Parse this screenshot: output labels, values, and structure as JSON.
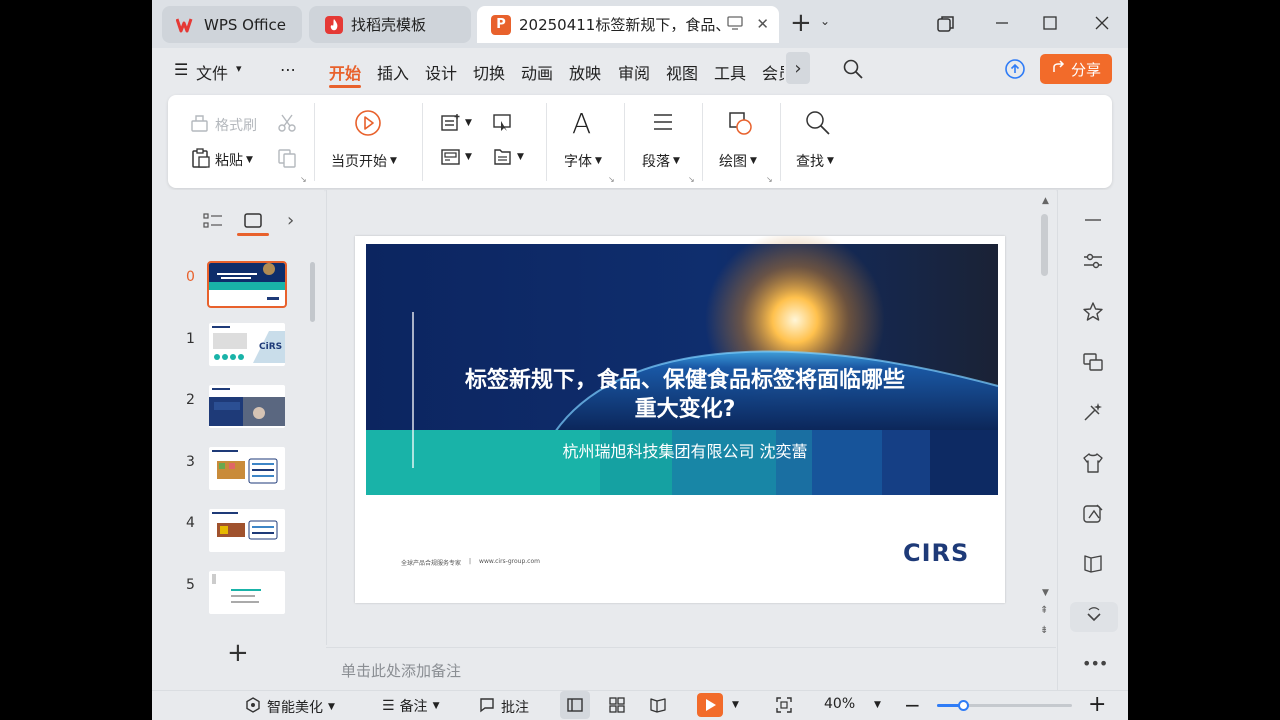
{
  "tabs": [
    {
      "label": "WPS Office",
      "icon": "wps-logo-icon"
    },
    {
      "label": "找稻壳模板",
      "icon": "docer-flame-icon"
    },
    {
      "label": "20250411标签新规下，食品、",
      "icon": "ppt-file-icon",
      "badge": "P"
    }
  ],
  "menu": {
    "file": "文件",
    "items": [
      "开始",
      "插入",
      "设计",
      "切换",
      "动画",
      "放映",
      "审阅",
      "视图",
      "工具",
      "会员"
    ],
    "active": "开始",
    "share": "分享"
  },
  "ribbon": {
    "format_painter": "格式刷",
    "paste": "粘贴",
    "play_from_current": "当页开始",
    "font": "字体",
    "paragraph": "段落",
    "drawing": "绘图",
    "find": "查找"
  },
  "slides_panel": {
    "numbers": [
      "0",
      "1",
      "2",
      "3",
      "4",
      "5"
    ],
    "selected": "0"
  },
  "slide": {
    "title_line1": "标签新规下，食品、保健食品标签将面临哪些",
    "title_line2": "重大变化?",
    "subtitle": "杭州瑞旭科技集团有限公司  沈奕蕾",
    "footer_left": "全球产品合规服务专家",
    "footer_sep": "|",
    "footer_url": "www.cirs-group.com",
    "logo": "CIRS"
  },
  "notes_placeholder": "单击此处添加备注",
  "statusbar": {
    "beautify": "智能美化",
    "notes": "备注",
    "comments": "批注",
    "zoom": "40%"
  },
  "colors": {
    "accent": "#e8612c",
    "share": "#f26b2a",
    "slide_navy": "#0d2a63",
    "slide_teal": "#19b3a8",
    "zoom_blue": "#2f7cf6"
  }
}
